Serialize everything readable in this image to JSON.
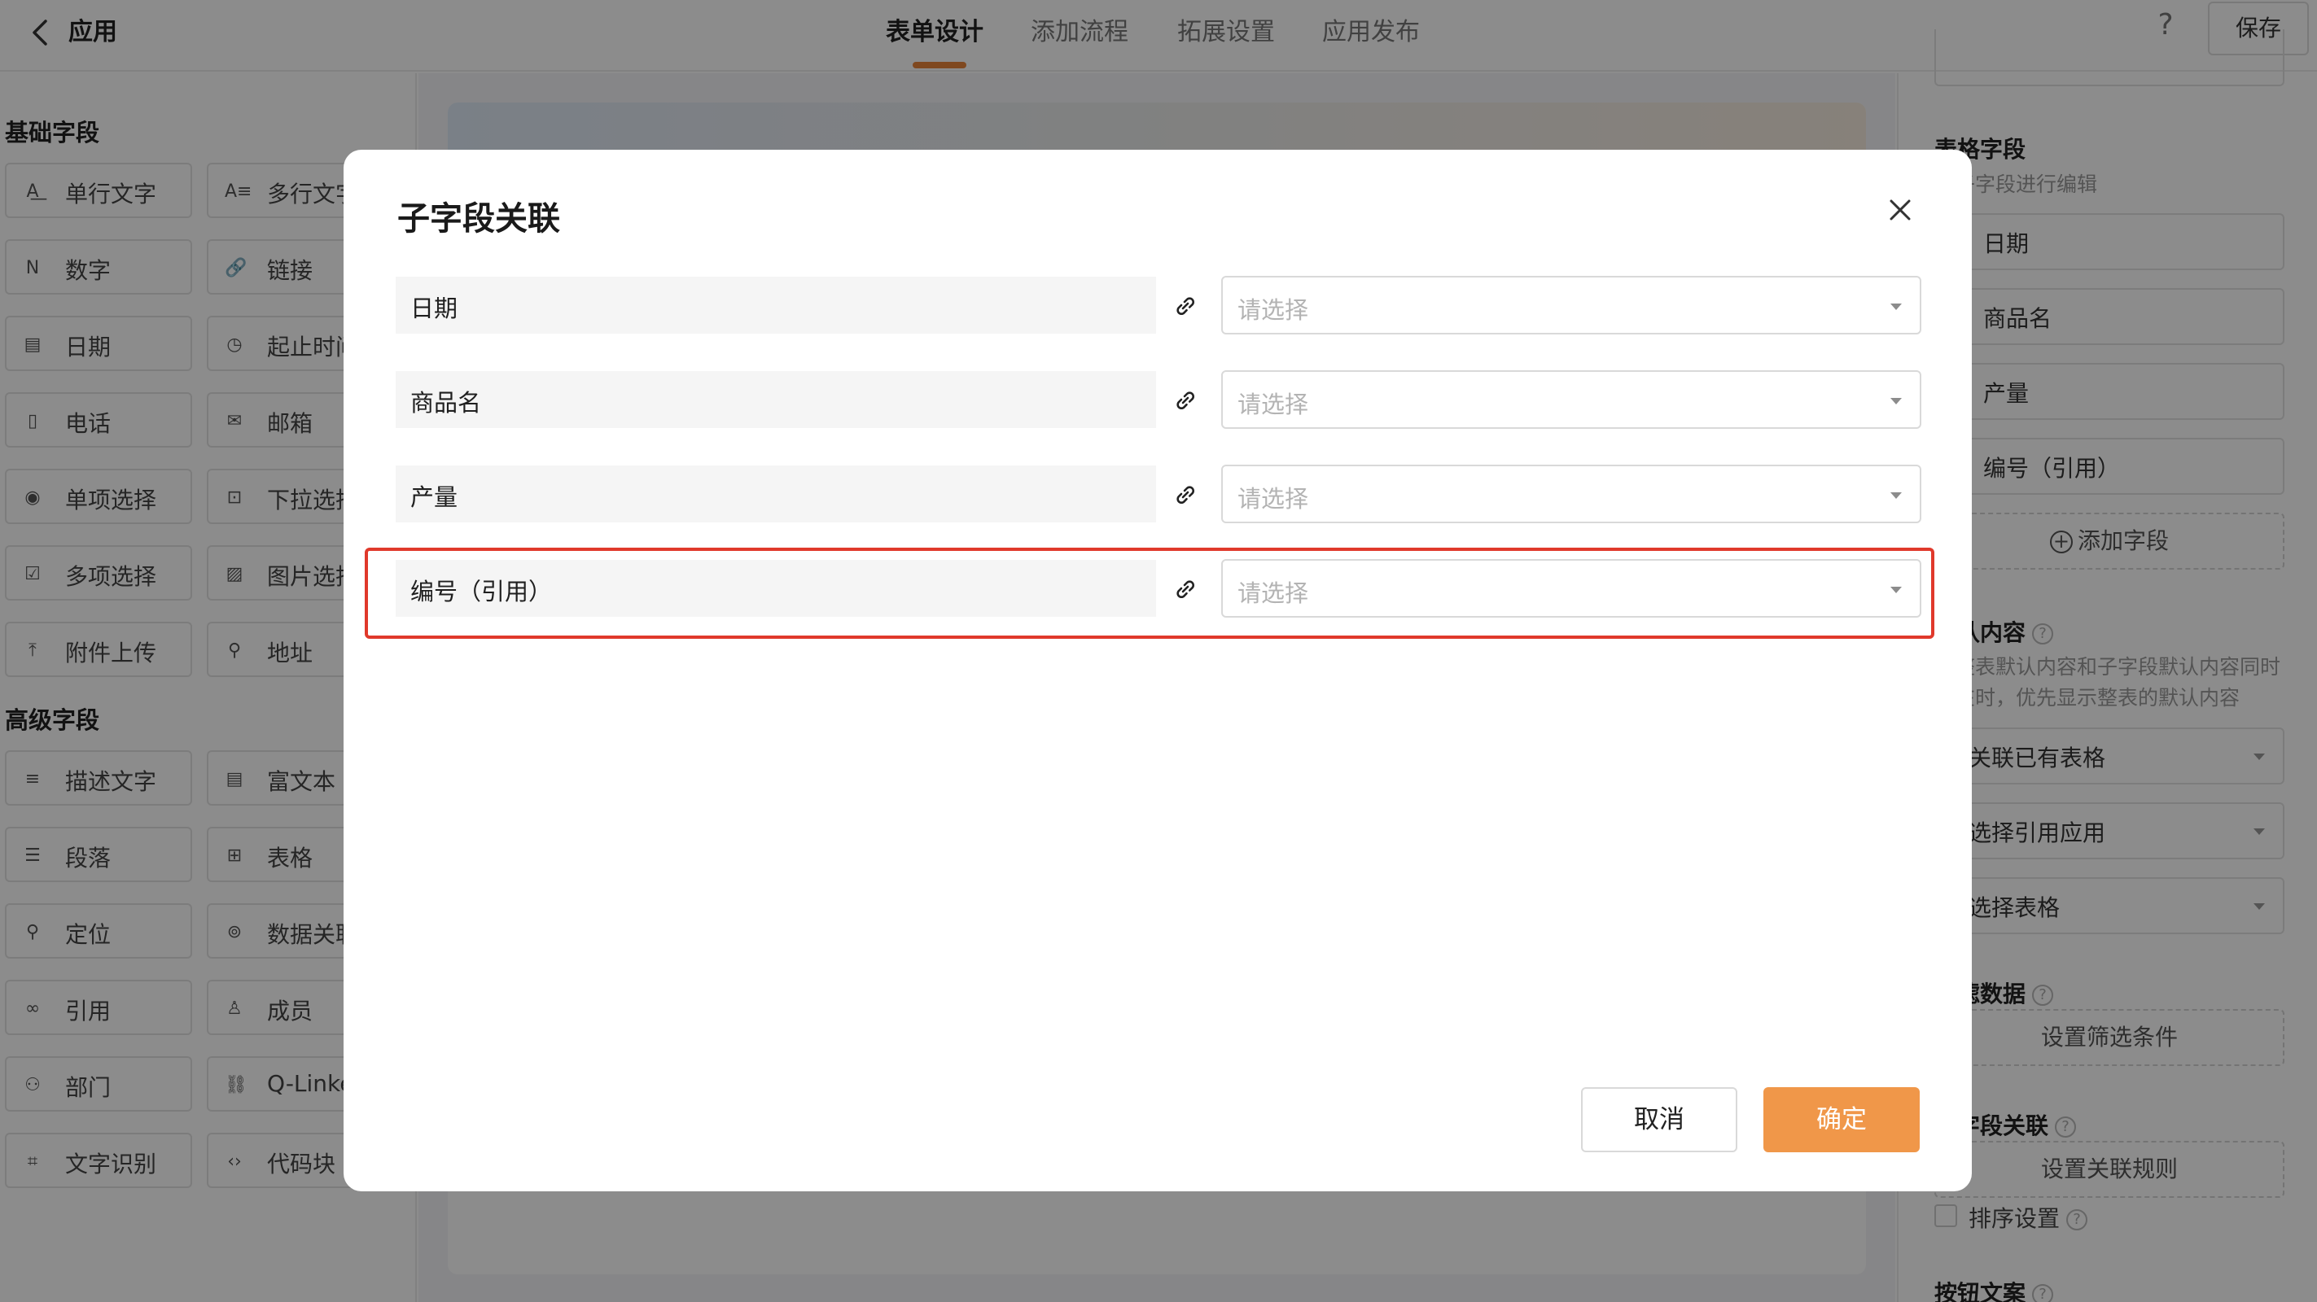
{
  "header": {
    "app_name": "应用",
    "tabs": [
      "表单设计",
      "添加流程",
      "拓展设置",
      "应用发布"
    ],
    "help": "?",
    "save_label": "保存"
  },
  "left_panel": {
    "basic_title": "基础字段",
    "basic_fields": [
      {
        "label": "单行文字",
        "icon": "single-line-text-icon",
        "glyph": "A͟"
      },
      {
        "label": "多行文字",
        "icon": "multi-line-text-icon",
        "glyph": "A≡"
      },
      {
        "label": "数字",
        "icon": "number-icon",
        "glyph": "N"
      },
      {
        "label": "链接",
        "icon": "link-icon",
        "glyph": "🔗"
      },
      {
        "label": "日期",
        "icon": "calendar-icon",
        "glyph": "▤"
      },
      {
        "label": "起止时间",
        "icon": "time-range-icon",
        "glyph": "◷"
      },
      {
        "label": "电话",
        "icon": "phone-icon",
        "glyph": "▯"
      },
      {
        "label": "邮箱",
        "icon": "mail-icon",
        "glyph": "✉"
      },
      {
        "label": "单项选择",
        "icon": "radio-icon",
        "glyph": "◉"
      },
      {
        "label": "下拉选择",
        "icon": "dropdown-icon",
        "glyph": "⊡"
      },
      {
        "label": "多项选择",
        "icon": "checkbox-icon",
        "glyph": "☑"
      },
      {
        "label": "图片选择",
        "icon": "image-select-icon",
        "glyph": "▨"
      },
      {
        "label": "附件上传",
        "icon": "upload-icon",
        "glyph": "⤒"
      },
      {
        "label": "地址",
        "icon": "location-pin-icon",
        "glyph": "⚲"
      }
    ],
    "advanced_title": "高级字段",
    "advanced_fields": [
      {
        "label": "描述文字",
        "icon": "description-icon",
        "glyph": "≡"
      },
      {
        "label": "富文本",
        "icon": "rich-text-icon",
        "glyph": "▤"
      },
      {
        "label": "段落",
        "icon": "paragraph-icon",
        "glyph": "☰"
      },
      {
        "label": "表格",
        "icon": "table-icon",
        "glyph": "⊞"
      },
      {
        "label": "定位",
        "icon": "position-icon",
        "glyph": "⚲"
      },
      {
        "label": "数据关联",
        "icon": "data-link-icon",
        "glyph": "⊚"
      },
      {
        "label": "引用",
        "icon": "reference-icon",
        "glyph": "∞"
      },
      {
        "label": "成员",
        "icon": "member-icon",
        "glyph": "♙"
      },
      {
        "label": "部门",
        "icon": "department-icon",
        "glyph": "⚇"
      },
      {
        "label": "Q-Linker",
        "icon": "q-linker-icon",
        "glyph": "⛓"
      },
      {
        "label": "文字识别",
        "icon": "ocr-icon",
        "glyph": "⌗"
      },
      {
        "label": "代码块",
        "icon": "code-icon",
        "glyph": "‹›"
      }
    ]
  },
  "right_panel": {
    "table_fields_title": "表格字段",
    "edit_hint": "对子字段进行编辑",
    "subfields": [
      "日期",
      "商品名",
      "产量",
      "编号（引用）"
    ],
    "add_field": "添加字段",
    "default_title": "默认内容",
    "default_hint": [
      "当整表默认内容和子字段默认内容同时",
      "存在时，优先显示整表的默认内容"
    ],
    "selects": [
      "关联已有表格",
      "选择引用应用",
      "选择表格"
    ],
    "filter_title": "过滤数据",
    "filter_btn": "设置筛选条件",
    "assoc_title": "子字段关联",
    "assoc_btn": "设置关联规则",
    "sort_label": "排序设置",
    "button_text_title": "按钮文案"
  },
  "modal": {
    "title": "子字段关联",
    "rows": [
      {
        "label": "日期",
        "placeholder": "请选择"
      },
      {
        "label": "商品名",
        "placeholder": "请选择"
      },
      {
        "label": "产量",
        "placeholder": "请选择"
      },
      {
        "label": "编号（引用）",
        "placeholder": "请选择"
      }
    ],
    "cancel_label": "取消",
    "ok_label": "确定"
  },
  "colors": {
    "accent": "#f09749",
    "tab_underline": "#e8833a",
    "highlight_border": "#e0392b",
    "overlay": "rgba(0,0,0,0.45)"
  }
}
